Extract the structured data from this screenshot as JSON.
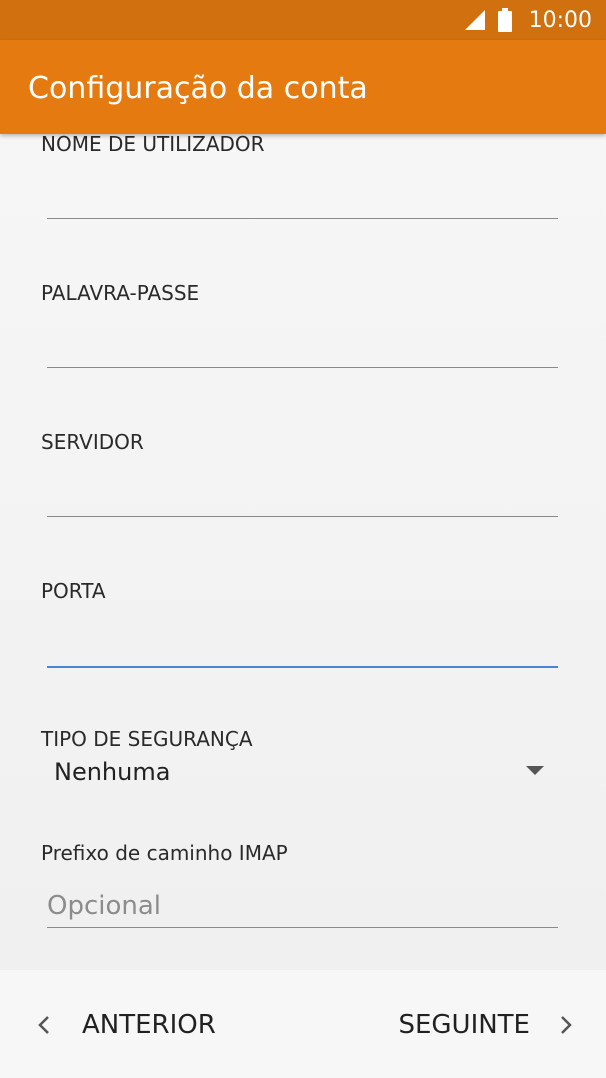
{
  "status_bar": {
    "time": "10:00",
    "icons": [
      "signal-icon",
      "battery-icon"
    ]
  },
  "app_bar": {
    "title": "Configuração da conta",
    "color": "#e57a11"
  },
  "form": {
    "username": {
      "label": "NOME DE UTILIZADOR",
      "value": ""
    },
    "password": {
      "label": "PALAVRA-PASSE",
      "value": ""
    },
    "server": {
      "label": "SERVIDOR",
      "value": ""
    },
    "port": {
      "label": "PORTA",
      "value": ""
    },
    "security": {
      "label": "TIPO DE SEGURANÇA",
      "selected": "Nenhuma"
    },
    "imap_prefix": {
      "label": "Prefixo de caminho IMAP",
      "placeholder": "Opcional",
      "value": ""
    }
  },
  "navigation": {
    "back_label": "ANTERIOR",
    "next_label": "SEGUINTE",
    "icons": [
      "chevron-left-icon",
      "chevron-right-icon"
    ]
  },
  "colors": {
    "status_bar": "#d0700e",
    "app_bar": "#e57a11",
    "focus_underline": "#4a84d8"
  }
}
